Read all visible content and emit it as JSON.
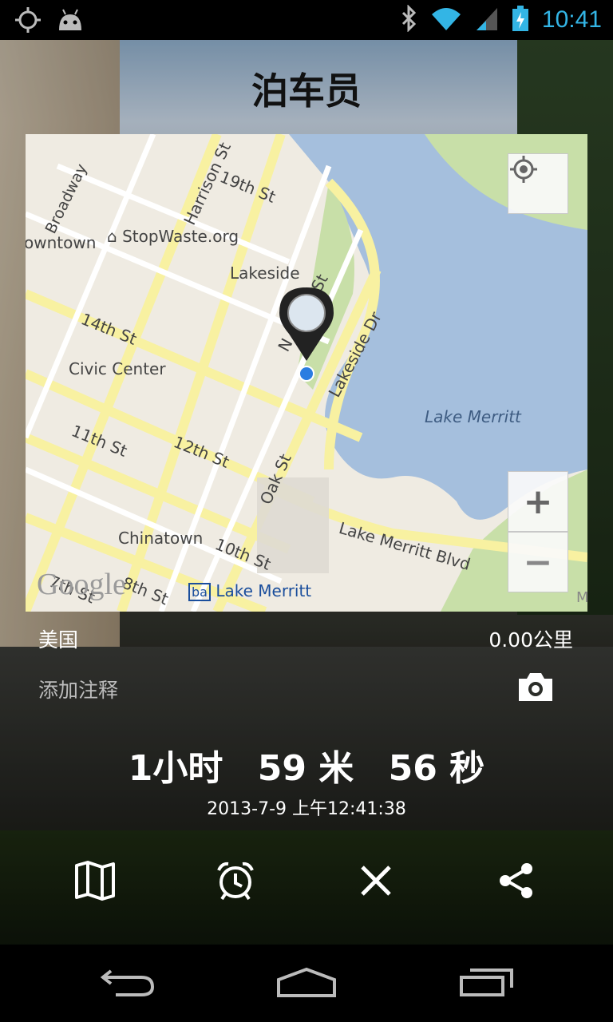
{
  "status_bar": {
    "time": "10:41",
    "icons": [
      "gps-icon",
      "android-debug-icon",
      "bluetooth-icon",
      "wifi-icon",
      "signal-icon",
      "battery-charging-icon"
    ]
  },
  "app": {
    "title": "泊车员"
  },
  "map": {
    "labels": {
      "broadway": "Broadway",
      "harrison": "Harrison St",
      "st19": "19th St",
      "downtown": "owntown",
      "stopwaste": "StopWaste.org",
      "lakeside": "Lakeside",
      "lakeside_dr": "Lakeside Dr",
      "madison": "N",
      "madison2": "St",
      "st14": "14th St",
      "civic_center": "Civic Center",
      "lake_merritt": "Lake Merritt",
      "st11": "11th St",
      "st12": "12th St",
      "oak": "Oak St",
      "chinatown": "Chinatown",
      "st10": "10th St",
      "lake_merritt_blvd": "Lake Merritt Blvd",
      "st8": "8th St",
      "st7": "7th St",
      "bart_station": "Lake Merritt",
      "merr": "Merri",
      "google": "Google",
      "bart_logo": "ba"
    },
    "zoom_in": "+",
    "zoom_out": "−"
  },
  "info": {
    "country": "美国",
    "distance": "0.00公里",
    "add_note": "添加注释"
  },
  "timer": {
    "hours": "1小时",
    "minutes": "59 米",
    "seconds": "56 秒"
  },
  "timestamp": "2013-7-9 上午12:41:38",
  "actions": [
    "map-icon",
    "alarm-icon",
    "close-icon",
    "share-icon"
  ],
  "nav": [
    "back-icon",
    "home-icon",
    "recent-apps-icon"
  ]
}
